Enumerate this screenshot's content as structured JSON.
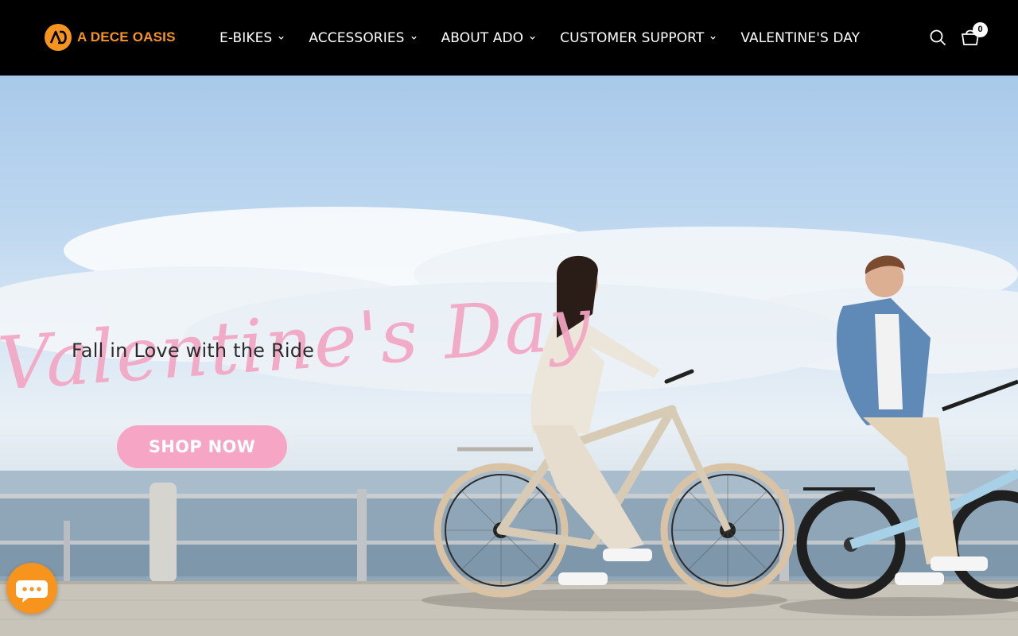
{
  "brand": {
    "name": "A DECE OASIS",
    "logo_icon": "ad-logo-icon",
    "accent_color": "#f7941d"
  },
  "nav": {
    "items": [
      {
        "label": "E-BIKES",
        "has_dropdown": true
      },
      {
        "label": "ACCESSORIES",
        "has_dropdown": true
      },
      {
        "label": "ABOUT ADO",
        "has_dropdown": true
      },
      {
        "label": "CUSTOMER SUPPORT",
        "has_dropdown": true
      },
      {
        "label": "VALENTINE'S DAY",
        "has_dropdown": false
      }
    ]
  },
  "header_actions": {
    "search_icon": "search-icon",
    "cart_icon": "shopping-basket-icon",
    "cart_count": "0"
  },
  "hero": {
    "script_text": "Valentine's Day",
    "headline": "Fall in Love with the Ride",
    "cta_label": "SHOP NOW",
    "cta_color": "#f6a6c4"
  },
  "chat": {
    "icon": "chat-bubble-icon"
  }
}
